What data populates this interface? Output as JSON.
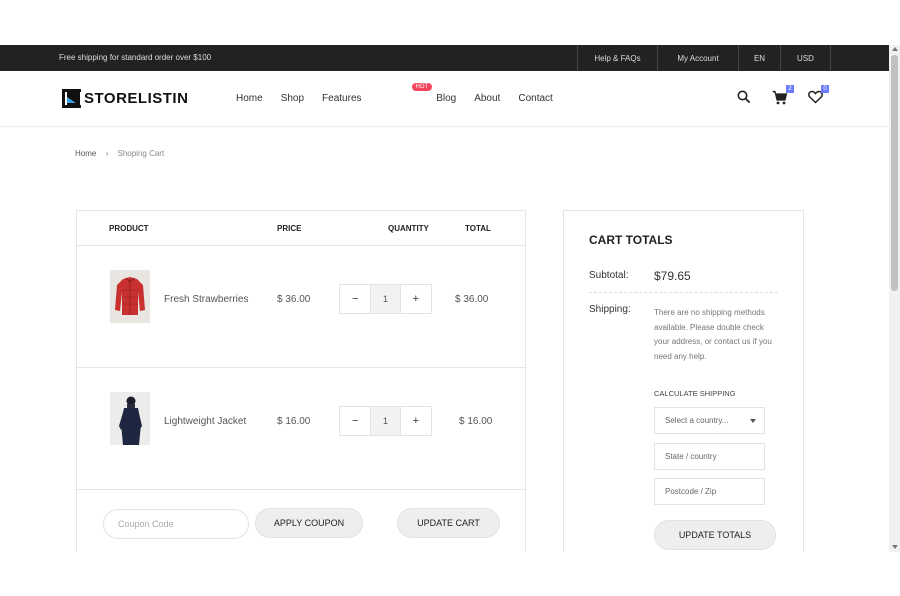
{
  "topbar": {
    "shipping_notice": "Free shipping for standard order over $100",
    "links": [
      "Help & FAQs",
      "My Account",
      "EN",
      "USD"
    ]
  },
  "header": {
    "logo": "STORELISTIN",
    "nav": [
      "Home",
      "Shop",
      "Features",
      "Blog",
      "About",
      "Contact"
    ],
    "hot_badge": "HOT",
    "cart_count": "2",
    "wishlist_count": "0"
  },
  "breadcrumb": {
    "home": "Home",
    "separator": "›",
    "current": "Shoping Cart"
  },
  "cart": {
    "columns": {
      "product": "PRODUCT",
      "price": "PRICE",
      "quantity": "QUANTITY",
      "total": "TOTAL"
    },
    "items": [
      {
        "name": "Fresh Strawberries",
        "price": "$ 36.00",
        "qty": "1",
        "total": "$ 36.00",
        "image": "red-jacket"
      },
      {
        "name": "Lightweight Jacket",
        "price": "$ 16.00",
        "qty": "1",
        "total": "$ 16.00",
        "image": "navy-jacket-model"
      }
    ],
    "qty_minus": "−",
    "qty_plus": "+",
    "coupon_placeholder": "Coupon Code",
    "apply_coupon": "APPLY COUPON",
    "update_cart": "UPDATE CART"
  },
  "totals": {
    "title": "CART TOTALS",
    "subtotal_label": "Subtotal:",
    "subtotal_value": "$79.65",
    "shipping_label": "Shipping:",
    "shipping_text": "There are no shipping methods available. Please double check your address, or contact us if you need any help.",
    "calculate_label": "CALCULATE SHIPPING",
    "country_select": "Select a country...",
    "state_placeholder": "State /  country",
    "postcode_placeholder": "Postcode / Zip",
    "update_totals": "UPDATE TOTALS"
  }
}
